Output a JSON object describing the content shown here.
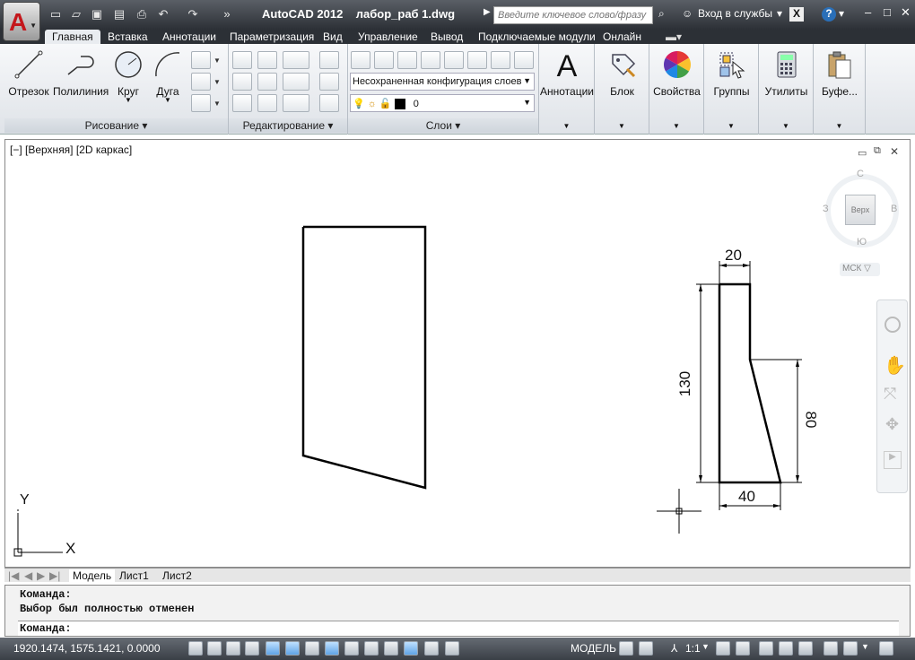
{
  "app": {
    "title": "AutoCAD 2012    лабор_раб 1.dwg",
    "search_placeholder": "Введите ключевое слово/фразу",
    "login": "Вход в службы"
  },
  "icons": [
    "autocad-logo-icon",
    "new-file-icon",
    "open-folder-icon",
    "save-icon",
    "save-as-icon",
    "print-icon",
    "undo-icon",
    "redo-icon"
  ],
  "ribbon": {
    "tabs": [
      "Главная",
      "Вставка",
      "Аннотации",
      "Параметризация",
      "Вид",
      "Управление",
      "Вывод",
      "Подключаемые модули",
      "Онлайн"
    ],
    "draw": {
      "items": [
        "Отрезок",
        "Полилиния",
        "Круг",
        "Дуга"
      ],
      "title": "Рисование"
    },
    "modify": {
      "title": "Редактирование"
    },
    "layers": {
      "config": "Несохраненная конфигурация слоев",
      "current": "0",
      "title": "Слои"
    },
    "big_buttons": [
      "Аннотации",
      "Блок",
      "Свойства",
      "Группы",
      "Утилиты",
      "Буфе..."
    ]
  },
  "viewport": {
    "label": "[−] [Верхняя] [2D каркас]"
  },
  "viewcube": {
    "north": "С",
    "south": "Ю",
    "west": "З",
    "east": "В",
    "face": "Верх",
    "ucs": "МСК"
  },
  "drawing": {
    "dims": {
      "top": "20",
      "height": "130",
      "bottom": "40",
      "right": "80"
    },
    "axis_x": "X",
    "axis_y": "Y"
  },
  "layout_tabs": [
    "Модель",
    "Лист1",
    "Лист2"
  ],
  "command": {
    "line1": "Команда:",
    "line2": "Выбор был полностью отменен",
    "prompt": "Команда:"
  },
  "status": {
    "coords": "1920.1474, 1575.1421, 0.0000",
    "mode": "МОДЕЛЬ",
    "scale": "1:1"
  }
}
